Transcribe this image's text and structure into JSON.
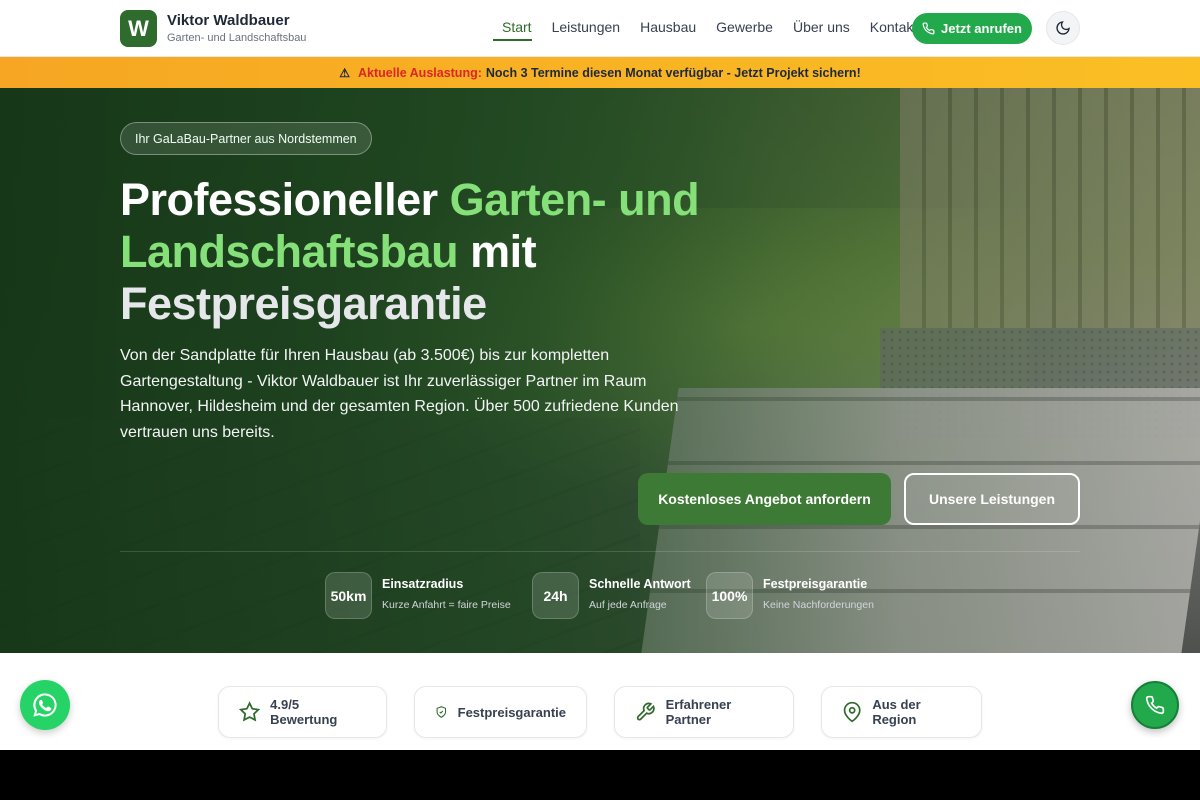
{
  "brand": {
    "logo_letter": "W",
    "name": "Viktor Waldbauer",
    "subtitle": "Garten- und Landschaftsbau"
  },
  "nav": {
    "items": [
      "Start",
      "Leistungen",
      "Hausbau",
      "Gewerbe",
      "Über uns",
      "Kontakt"
    ],
    "active": "Start"
  },
  "header": {
    "call_label": "Jetzt anrufen",
    "theme_icon": "moon-icon"
  },
  "banner": {
    "label": "Aktuelle Auslastung:",
    "text": "Noch 3 Termine diesen Monat verfügbar - Jetzt Projekt sichern!"
  },
  "hero": {
    "badge": "Ihr GaLaBau-Partner aus Nordstemmen",
    "title_part1": "Professioneller ",
    "title_highlight": "Garten- und Landschaftsbau",
    "title_part2": " mit ",
    "title_part3": "Festpreisgarantie",
    "text": "Von der Sandplatte für Ihren Hausbau (ab 3.500€) bis zur kompletten Gartengestaltung - Viktor Waldbauer ist Ihr zuverlässiger Partner im Raum Hannover, Hildesheim und der gesamten Region. Über 500 zufriedene Kunden vertrauen uns bereits.",
    "cta_primary": "Kostenloses Angebot anfordern",
    "cta_secondary": "Unsere Leistungen",
    "stats": [
      {
        "value": "50km",
        "title": "Einsatzradius",
        "sub": "Kurze Anfahrt = faire Preise"
      },
      {
        "value": "24h",
        "title": "Schnelle Antwort",
        "sub": "Auf jede Anfrage"
      },
      {
        "value": "100%",
        "title": "Festpreisgarantie",
        "sub": "Keine Nachforderungen"
      }
    ]
  },
  "trust": [
    {
      "icon": "star-icon",
      "label": "4.9/5 Bewertung"
    },
    {
      "icon": "shield-check-icon",
      "label": "Festpreisgarantie"
    },
    {
      "icon": "wrench-icon",
      "label": "Erfahrener Partner"
    },
    {
      "icon": "map-pin-icon",
      "label": "Aus der Region"
    }
  ],
  "colors": {
    "primary": "#2f6b2c",
    "accent_green": "#22a94b",
    "highlight": "#86e07a",
    "banner": "#fbbf24",
    "banner_label": "#dc2626"
  }
}
